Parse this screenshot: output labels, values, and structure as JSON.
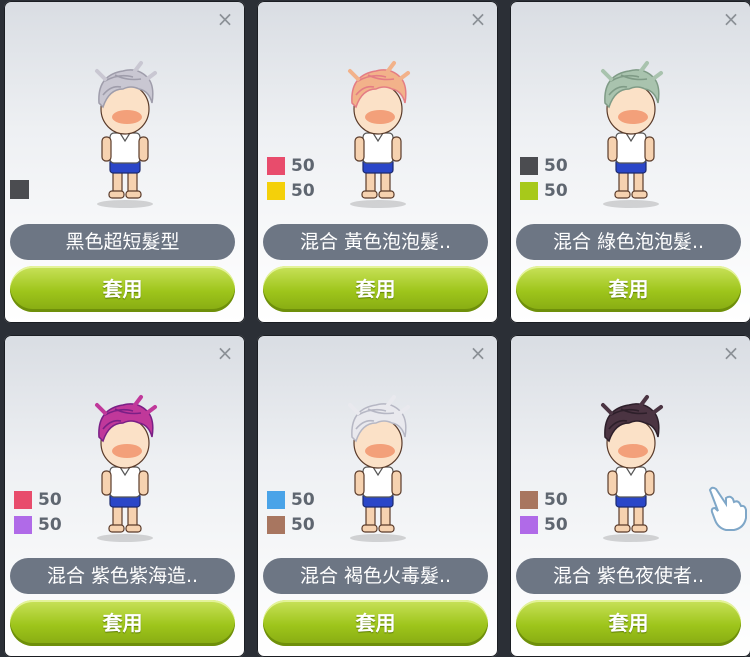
{
  "cards": [
    {
      "name": "黑色超短髮型",
      "apply": "套用",
      "close": "×",
      "colors": [
        {
          "color": "#4b4c50"
        }
      ],
      "hair": {
        "main": "#c9c7d2",
        "shade": "#9f9dab"
      }
    },
    {
      "name": "混合  黃色泡泡髮..",
      "apply": "套用",
      "close": "×",
      "colors": [
        {
          "color": "#e84c6c",
          "pct": "50"
        },
        {
          "color": "#f4d00a",
          "pct": "50"
        }
      ],
      "hair": {
        "main": "#f2b28a",
        "shade": "#e47d84"
      }
    },
    {
      "name": "混合  綠色泡泡髮..",
      "apply": "套用",
      "close": "×",
      "colors": [
        {
          "color": "#4b4c50",
          "pct": "50"
        },
        {
          "color": "#a7c91a",
          "pct": "50"
        }
      ],
      "hair": {
        "main": "#a9c3ae",
        "shade": "#7f9b86"
      }
    },
    {
      "name": "混合  紫色紫海造..",
      "apply": "套用",
      "close": "×",
      "colors": [
        {
          "color": "#e84c6c",
          "pct": "50"
        },
        {
          "color": "#b06ae8",
          "pct": "50"
        }
      ],
      "hair": {
        "main": "#c0389a",
        "shade": "#7a1f86"
      }
    },
    {
      "name": "混合  褐色火毒髮..",
      "apply": "套用",
      "close": "×",
      "colors": [
        {
          "color": "#4aa3e8",
          "pct": "50"
        },
        {
          "color": "#a87660",
          "pct": "50"
        }
      ],
      "hair": {
        "main": "#e9e9ee",
        "shade": "#b6b7c4"
      }
    },
    {
      "name": "混合  紫色夜使者..",
      "apply": "套用",
      "close": "×",
      "colors": [
        {
          "color": "#a87660",
          "pct": "50"
        },
        {
          "color": "#b06ae8",
          "pct": "50"
        }
      ],
      "hair": {
        "main": "#4b3442",
        "shade": "#2d1f2a"
      }
    }
  ]
}
